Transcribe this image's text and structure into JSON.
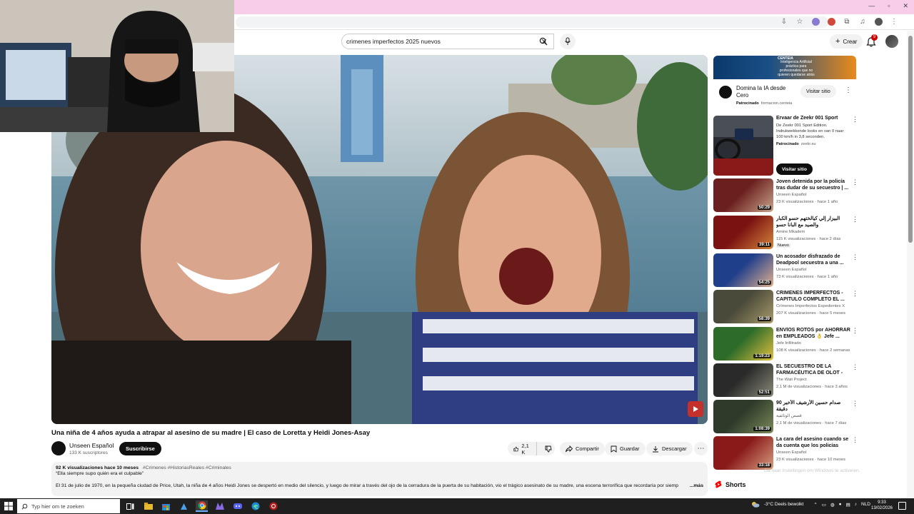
{
  "header": {
    "search_value": "crimenes imperfectos 2025 nuevos",
    "create_label": "Crear",
    "notification_count": "9"
  },
  "video": {
    "title": "Una niña de 4 años ayuda a atrapar al asesino de su madre | El caso de Loretta y Heidi Jones-Asay",
    "channel_name": "Unseen Español",
    "subscribers": "133 K suscriptores",
    "subscribe_label": "Suscribirse",
    "likes": "2,1 K",
    "share_label": "Compartir",
    "save_label": "Guardar",
    "download_label": "Descargar"
  },
  "description": {
    "views": "92 K visualizaciones",
    "age": "hace 10 meses",
    "hashtags": "#Crimenes #HistoriasReales #Criminales",
    "quote": "“Ella siempre supo quién era el culpable”",
    "text": "El 31 de julio de 1970, en la pequeña ciudad de Price, Utah, la niña de 4 años Heidi Jones se despertó en medio del silencio, y luego de mirar a través del ojo de la cerradura de la puerta de su habitación, vio el trágico asesinato de su madre, una escena terrorífica que recordaría por siemp",
    "more_label": "...más"
  },
  "sidebar": {
    "ad_top": {
      "banner_brand": "CENTEIA",
      "banner_text": "Inteligencia Artificial práctica para profesionales que no quieren quedarse atrás",
      "title": "Domina la IA desde Cero",
      "sponsor_label": "Patrocinado",
      "sponsor_domain": "formacion.centeia",
      "visit_label": "Visitar sitio"
    },
    "ad_zeekr": {
      "title": "Ervaar de Zeekr 001 Sport",
      "desc": "De Zeekr 001 Sport Edition. Indrukwekkende looks en van 0 naar 100 km/h in 3,8 seconden.",
      "sponsor_label": "Patrocinado",
      "sponsor_domain": "zeekr.eu",
      "visit_label": "Visitar sitio"
    },
    "recommendations": [
      {
        "title": "Joven detenida por la policía tras dudar de su secuestro | ...",
        "channel": "Unseen Español",
        "stats": "23 K visualizaciones · hace 1 año",
        "duration": "50:29",
        "color1": "#6b1f1f",
        "color2": "#c9a48a"
      },
      {
        "title": "البيزار إلي كيالختهم حسو الكبار والصيد مع البانا حسو",
        "channel": "Amine Mkadem",
        "stats": "115 K visualizaciones · hace 2 días",
        "duration": "39:11",
        "badge": "Nuevo",
        "color1": "#7a1212",
        "color2": "#d6863a"
      },
      {
        "title": "Un acosador disfrazado de Deadpool secuestra a una ...",
        "channel": "Unseen Español",
        "stats": "73 K visualizaciones · hace 1 año",
        "duration": "54:25",
        "color1": "#1f3f8a",
        "color2": "#e0b090"
      },
      {
        "title": "CRIMENES IMPERFECTOS - CAPITULO COMPLETO EL ...",
        "channel": "Crímenes Imperfectos Expedientes X",
        "stats": "207 K visualizaciones · hace 5 meses",
        "duration": "58:39",
        "color1": "#4a4a3a",
        "color2": "#a89a6a"
      },
      {
        "title": "ENVÍOS ROTOS por AHORRAR en EMPLEADOS 👌 Jefe ...",
        "channel": "Jefe Infiltrado",
        "stats": "108 K visualizaciones · hace 2 semanas",
        "duration": "1:19:23",
        "color1": "#2c6b2a",
        "color2": "#e0c040"
      },
      {
        "title": "EL SECUESTRO DE LA FARMACÉUTICA DE OLOT - Un...",
        "channel": "The Wait Project",
        "stats": "2,1 M de visualizaciones · hace 3 años",
        "duration": "52:51",
        "color1": "#2a2a2a",
        "color2": "#8a8a7a"
      },
      {
        "title": "صدام حسين الأرشيف الأخير 90 دقيقة",
        "channel": "قصص الوثائقية",
        "stats": "2,1 M de visualizaciones · hace 7 días",
        "duration": "1:08:39",
        "color1": "#2e3a2a",
        "color2": "#7a8a5a"
      },
      {
        "title": "La cara del asesino cuando se da cuenta que los policías est...",
        "channel": "Unseen Español",
        "stats": "23 K visualizaciones · hace 10 meses",
        "duration": "33:18",
        "color1": "#8a1a1a",
        "color2": "#d8a080"
      }
    ],
    "shorts_label": "Shorts",
    "windows_watermark": "Ga naar Instellingen om Windows te activeren."
  },
  "taskbar": {
    "search_placeholder": "Typ hier om te zoeken",
    "weather": "-3°C  Deels bewolkt",
    "language": "NLD",
    "time": "9:33",
    "date": "13/02/2026"
  },
  "colors": {
    "youtube_red": "#ff0000",
    "titlebar_pink": "#f7cde9",
    "taskbar": "#1f1f1f"
  }
}
